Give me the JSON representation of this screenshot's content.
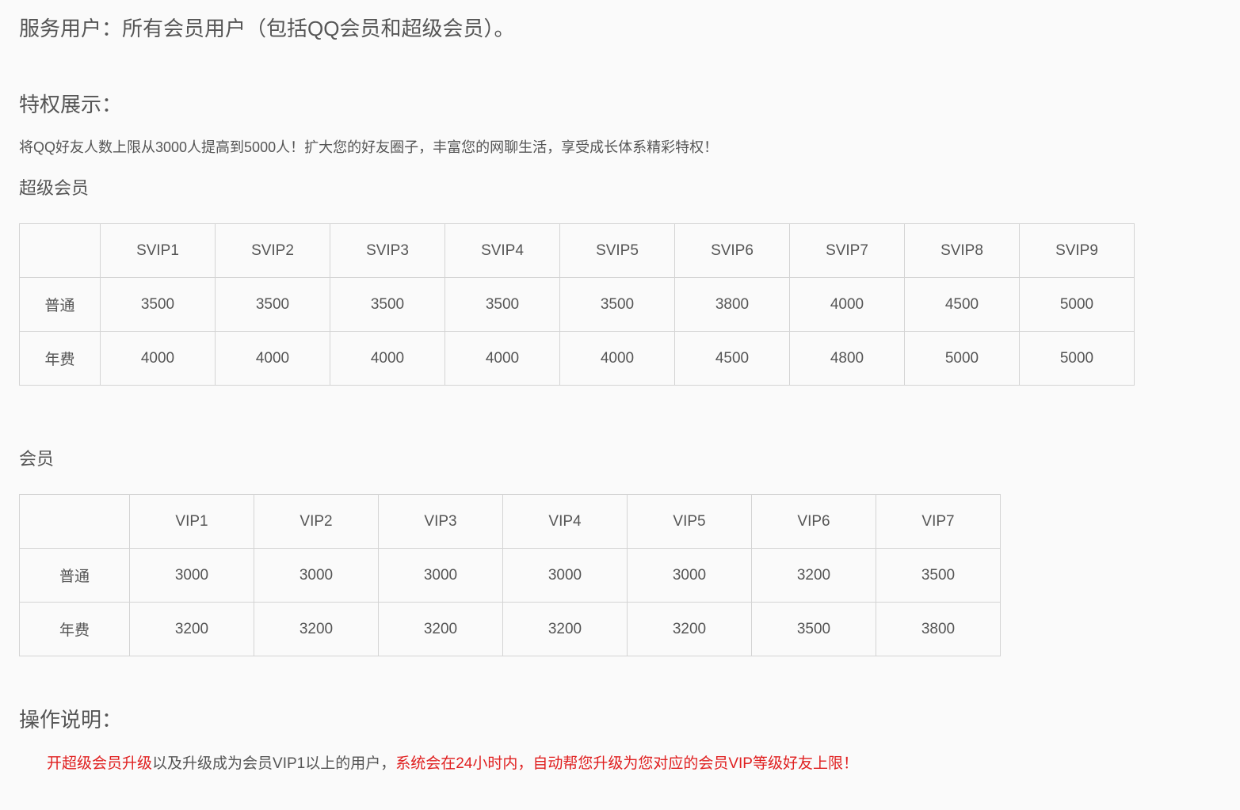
{
  "service_users": "服务用户：所有会员用户（包括QQ会员和超级会员）。",
  "privilege": {
    "title": "特权展示：",
    "description": "将QQ好友人数上限从3000人提高到5000人！扩大您的好友圈子，丰富您的网聊生活，享受成长体系精彩特权！"
  },
  "svip": {
    "title": "超级会员",
    "corner": "",
    "levels": [
      "SVIP1",
      "SVIP2",
      "SVIP3",
      "SVIP4",
      "SVIP5",
      "SVIP6",
      "SVIP7",
      "SVIP8",
      "SVIP9"
    ],
    "rows": [
      {
        "label": "普通",
        "values": [
          "3500",
          "3500",
          "3500",
          "3500",
          "3500",
          "3800",
          "4000",
          "4500",
          "5000"
        ]
      },
      {
        "label": "年费",
        "values": [
          "4000",
          "4000",
          "4000",
          "4000",
          "4000",
          "4500",
          "4800",
          "5000",
          "5000"
        ]
      }
    ]
  },
  "vip": {
    "title": "会员",
    "corner": "",
    "levels": [
      "VIP1",
      "VIP2",
      "VIP3",
      "VIP4",
      "VIP5",
      "VIP6",
      "VIP7"
    ],
    "rows": [
      {
        "label": "普通",
        "values": [
          "3000",
          "3000",
          "3000",
          "3000",
          "3000",
          "3200",
          "3500"
        ]
      },
      {
        "label": "年费",
        "values": [
          "3200",
          "3200",
          "3200",
          "3200",
          "3200",
          "3500",
          "3800"
        ]
      }
    ]
  },
  "operation": {
    "title": "操作说明：",
    "note_part1": "开超级会员升级",
    "note_part2": "以及升级成为会员VIP1以上的用户，",
    "note_part3": "系统会在24小时内，自动帮您升级为您对应的会员VIP等级好友上限！"
  },
  "colors": {
    "text": "#555555",
    "highlight": "#e02020",
    "border": "#d4d4d4",
    "background": "#fafafa"
  }
}
